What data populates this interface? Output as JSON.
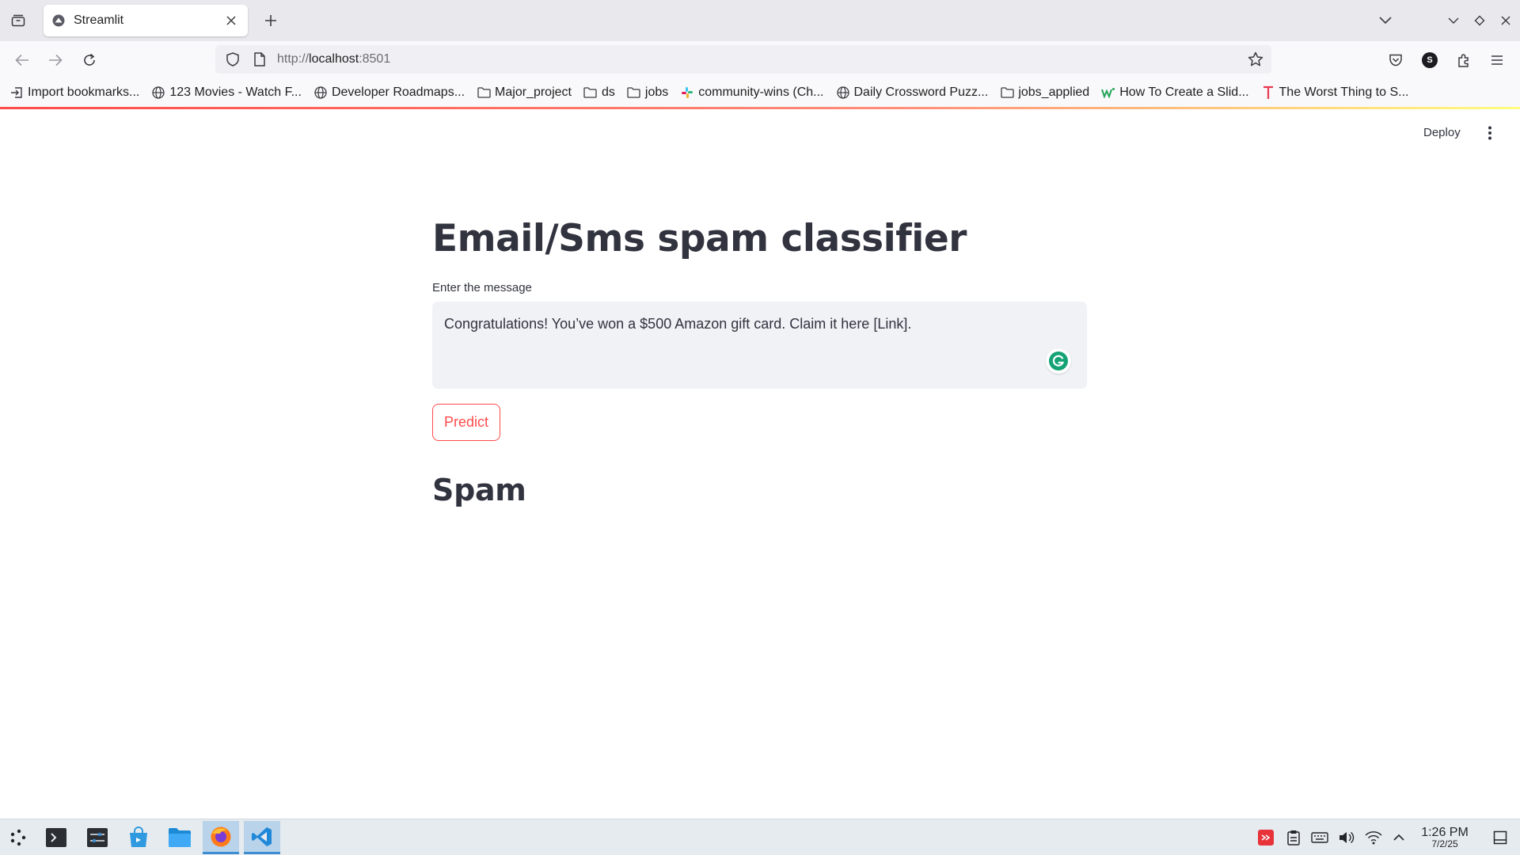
{
  "browser": {
    "tab": {
      "title": "Streamlit"
    },
    "url": {
      "scheme": "http://",
      "host": "localhost",
      "port": ":8501"
    },
    "bookmarks": [
      {
        "label": "Import bookmarks...",
        "icon": "import-icon"
      },
      {
        "label": "123 Movies - Watch F...",
        "icon": "globe-icon"
      },
      {
        "label": "Developer Roadmaps...",
        "icon": "globe-icon"
      },
      {
        "label": "Major_project",
        "icon": "folder-icon"
      },
      {
        "label": "ds",
        "icon": "folder-icon"
      },
      {
        "label": "jobs",
        "icon": "folder-icon"
      },
      {
        "label": "community-wins (Ch...",
        "icon": "slack-icon"
      },
      {
        "label": "Daily Crossword Puzz...",
        "icon": "globe-icon"
      },
      {
        "label": "jobs_applied",
        "icon": "folder-icon"
      },
      {
        "label": "How To Create a Slid...",
        "icon": "wikihow-icon"
      },
      {
        "label": "The Worst Thing to S...",
        "icon": "t-logo-icon"
      }
    ],
    "profile_initial": "S"
  },
  "app": {
    "deploy_label": "Deploy",
    "title": "Email/Sms spam classifier",
    "input_label": "Enter the message",
    "input_value": "Congratulations! You’ve won a $500 Amazon gift card. Claim it here [Link].",
    "button_label": "Predict",
    "result": "Spam",
    "accent_color": "#ff4b4b"
  },
  "taskbar": {
    "apps": [
      "launcher-icon",
      "terminal-icon",
      "system-monitor-icon",
      "software-store-icon",
      "file-manager-icon",
      "firefox-icon",
      "vscode-icon"
    ],
    "time": "1:26 PM",
    "date": "7/2/25"
  }
}
